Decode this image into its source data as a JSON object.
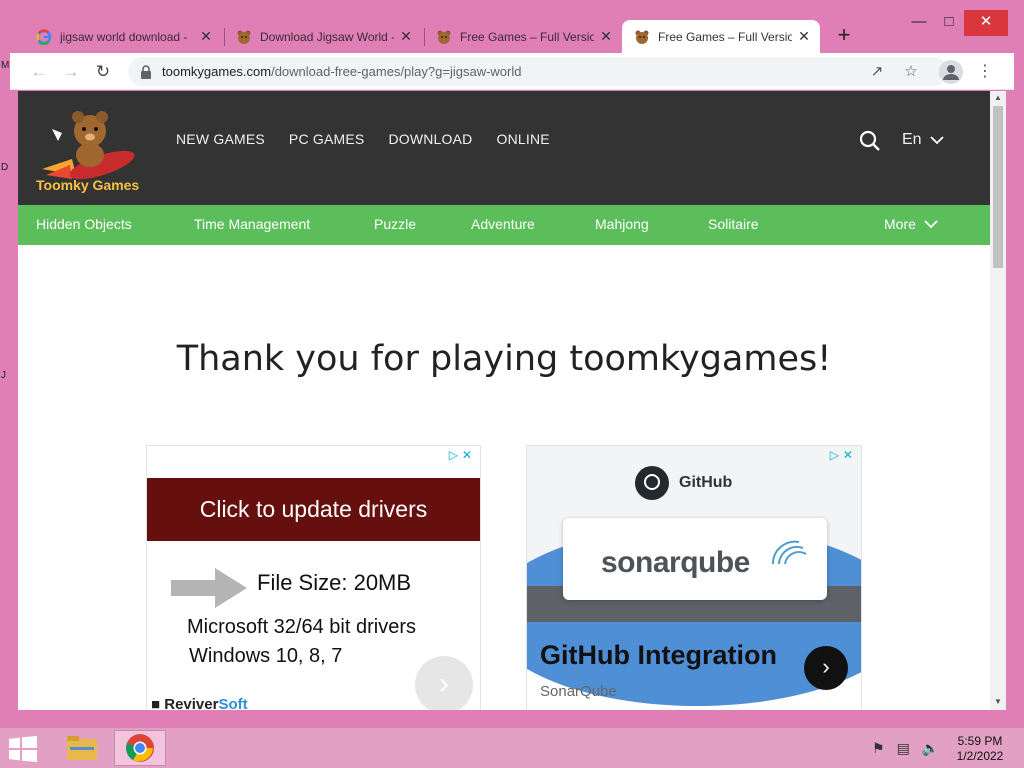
{
  "desktop": {
    "side_letters": [
      "M",
      "D",
      "J"
    ]
  },
  "browser": {
    "tabs": [
      {
        "title": "jigsaw world download -",
        "icon": "google-icon",
        "active": false
      },
      {
        "title": "Download Jigsaw World -",
        "icon": "bear-favicon",
        "active": false
      },
      {
        "title": "Free Games – Full Version",
        "icon": "bear-favicon",
        "active": false
      },
      {
        "title": "Free Games – Full Version",
        "icon": "bear-favicon",
        "active": true
      }
    ],
    "url_domain": "toomkygames.com",
    "url_path": "/download-free-games/play?g=jigsaw-world"
  },
  "site": {
    "logo_text": "Toomky Games",
    "main_nav": [
      "NEW GAMES",
      "PC GAMES",
      "DOWNLOAD",
      "ONLINE"
    ],
    "language": "En",
    "categories": [
      "Hidden Objects",
      "Time Management",
      "Puzzle",
      "Adventure",
      "Mahjong",
      "Solitaire"
    ],
    "more_label": "More",
    "thanks_heading": "Thank you for playing toomkygames!"
  },
  "ad_left": {
    "banner": "Click to update drivers",
    "file_size": "File Size: 20MB",
    "line1": "Microsoft 32/64 bit drivers",
    "line2": "Windows 10, 8, 7",
    "brand_a": "Reviver",
    "brand_b": "Soft"
  },
  "ad_right": {
    "github_label": "GitHub",
    "product": "sonarqube",
    "headline": "GitHub Integration",
    "advertiser": "SonarQube"
  },
  "taskbar": {
    "time": "5:59 PM",
    "date": "1/2/2022"
  },
  "colors": {
    "window_frame": "#e07fb6",
    "site_header": "#333333",
    "category_bar": "#5cbd5b",
    "ad_banner": "#650f0f"
  }
}
